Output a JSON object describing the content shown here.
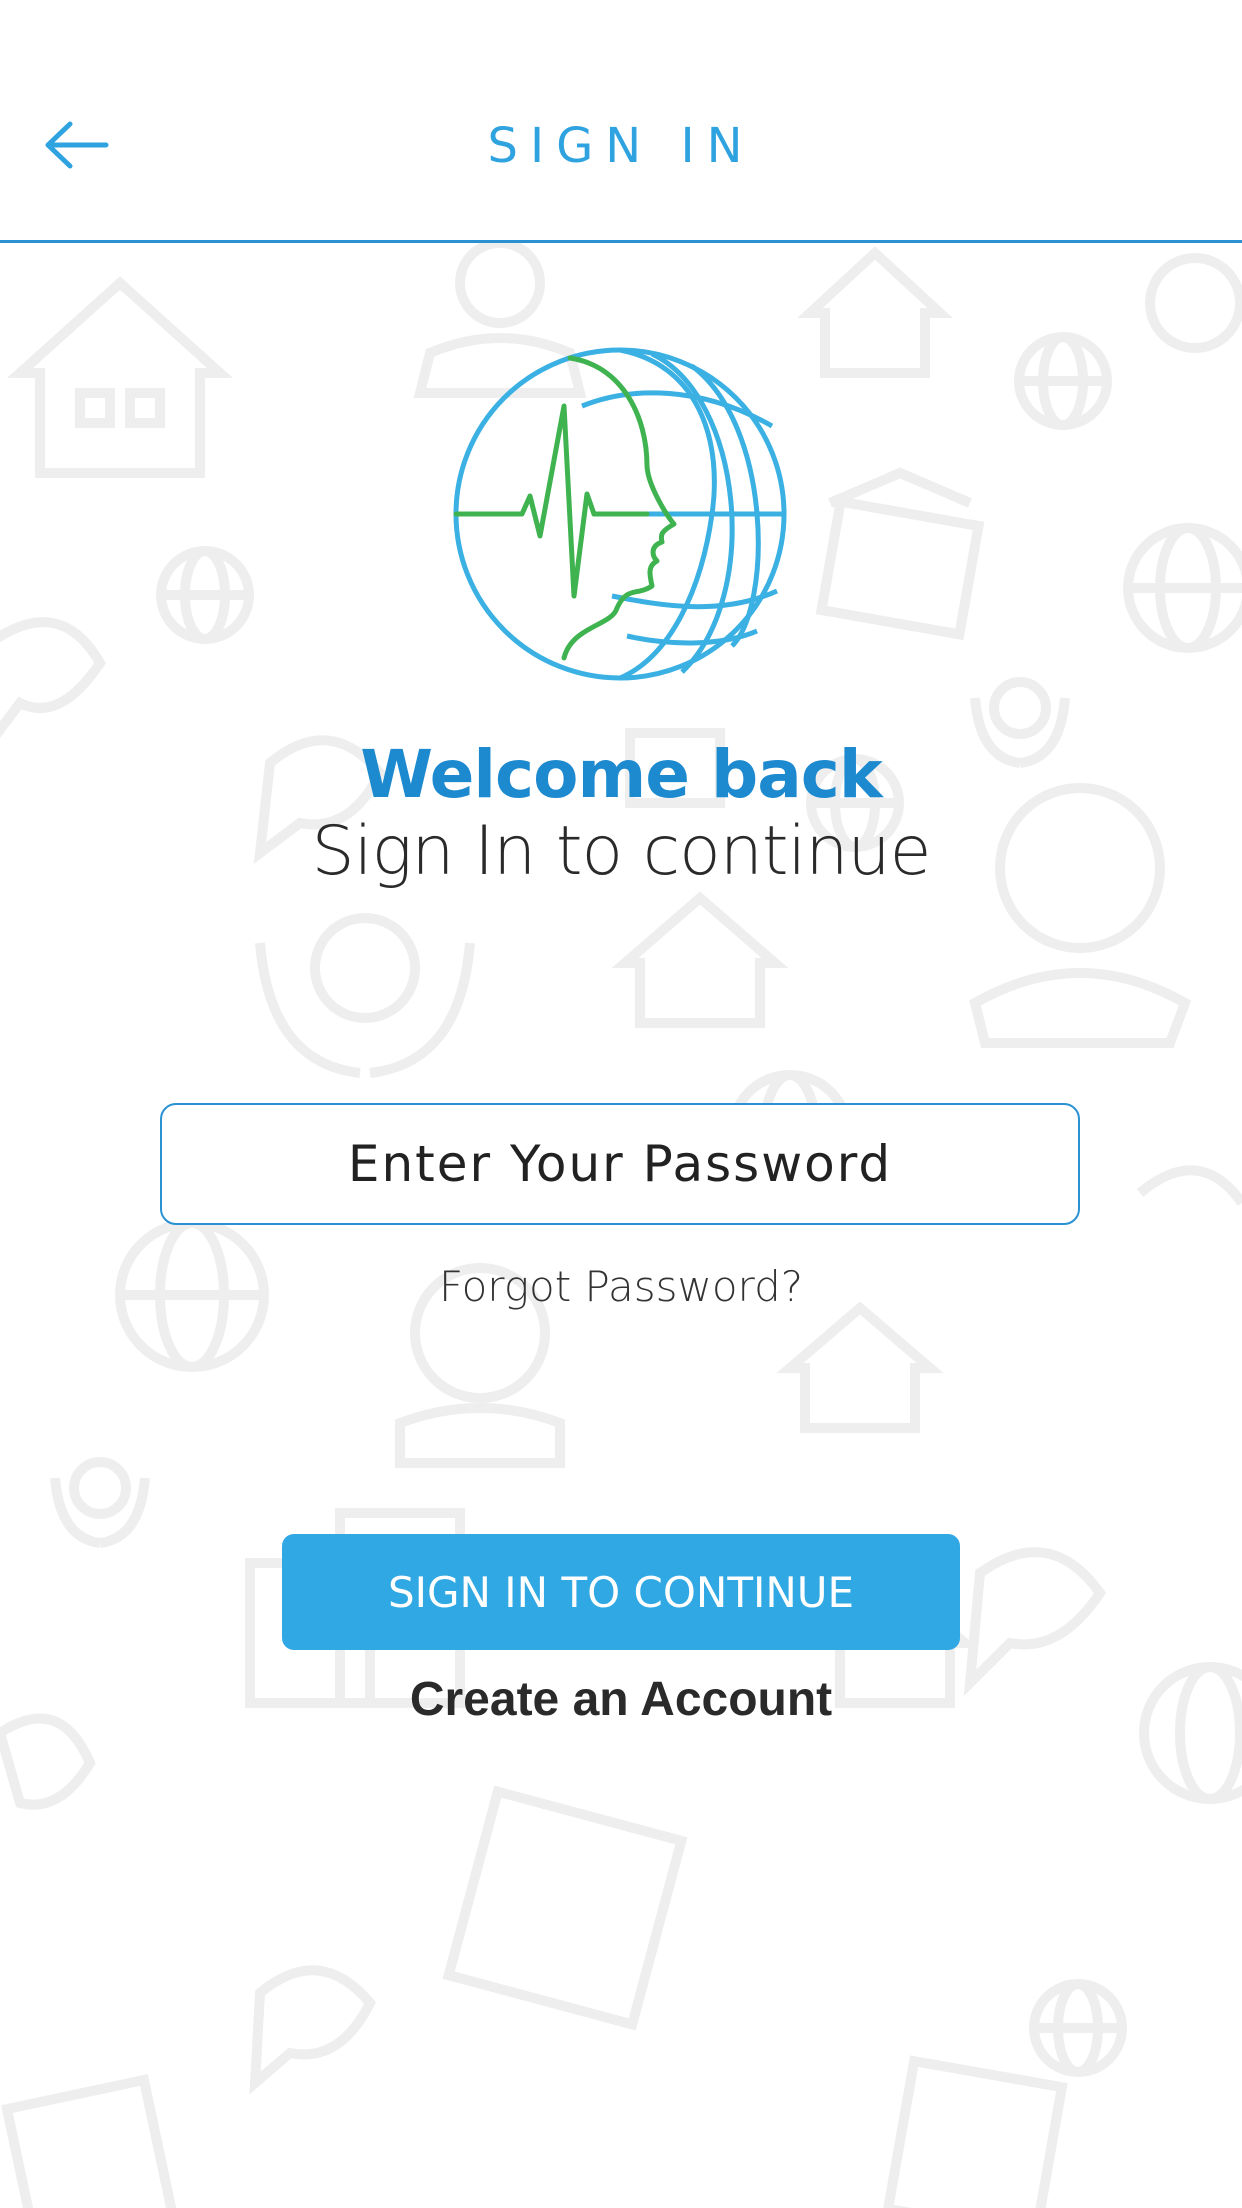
{
  "header": {
    "title": "SIGN IN",
    "back_icon": "arrow-left-icon",
    "accent_color": "#2fa3df"
  },
  "logo": {
    "icon": "globe-face-heartbeat-logo",
    "globe_color": "#3bb0e3",
    "pulse_color": "#3fb34f"
  },
  "welcome": {
    "title": "Welcome back",
    "subtitle": "Sign In to continue"
  },
  "form": {
    "password_placeholder": "Enter Your Password",
    "password_value": "",
    "forgot_label": "Forgot Password?"
  },
  "actions": {
    "signin_label": "SIGN IN TO CONTINUE",
    "create_account_label": "Create an Account",
    "button_color": "#2fa8e4"
  },
  "background": {
    "pattern_icons": [
      "house-icon",
      "globe-icon",
      "doctor-icon",
      "phone-chat-icon",
      "care-hands-icon",
      "building-icon",
      "hospital-icon",
      "bank-icon"
    ]
  }
}
